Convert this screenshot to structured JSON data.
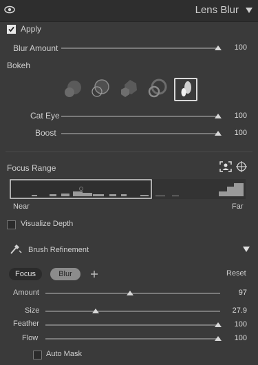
{
  "header": {
    "title": "Lens Blur"
  },
  "apply": {
    "label": "Apply",
    "checked": true
  },
  "blur_amount": {
    "label": "Blur Amount",
    "value": "100",
    "fraction": 1.0
  },
  "bokeh": {
    "label": "Bokeh",
    "shapes": [
      "circle",
      "ring",
      "blade",
      "cat-eye",
      "oval"
    ],
    "selected_index": 4
  },
  "cat_eye": {
    "label": "Cat Eye",
    "value": "100",
    "fraction": 1.0
  },
  "boost": {
    "label": "Boost",
    "value": "100",
    "fraction": 1.0
  },
  "focus_range": {
    "label": "Focus Range",
    "near_label": "Near",
    "far_label": "Far"
  },
  "visualize_depth": {
    "label": "Visualize Depth",
    "checked": false
  },
  "brush_refinement": {
    "label": "Brush Refinement"
  },
  "brush_tabs": {
    "focus": "Focus",
    "blur": "Blur",
    "reset": "Reset"
  },
  "sliders": [
    {
      "label": "Amount",
      "value": "97",
      "fraction": 0.485
    },
    {
      "label": "Size",
      "value": "27.9",
      "fraction": 0.279
    },
    {
      "label": "Feather",
      "value": "100",
      "fraction": 1.0
    },
    {
      "label": "Flow",
      "value": "100",
      "fraction": 1.0
    }
  ],
  "auto_mask": {
    "label": "Auto Mask",
    "checked": false
  },
  "colors": {
    "panel_bg": "#3a3a3a",
    "header_bg": "#2e2e2e",
    "text": "#cfcfcf",
    "track": "#7a7a7a"
  }
}
